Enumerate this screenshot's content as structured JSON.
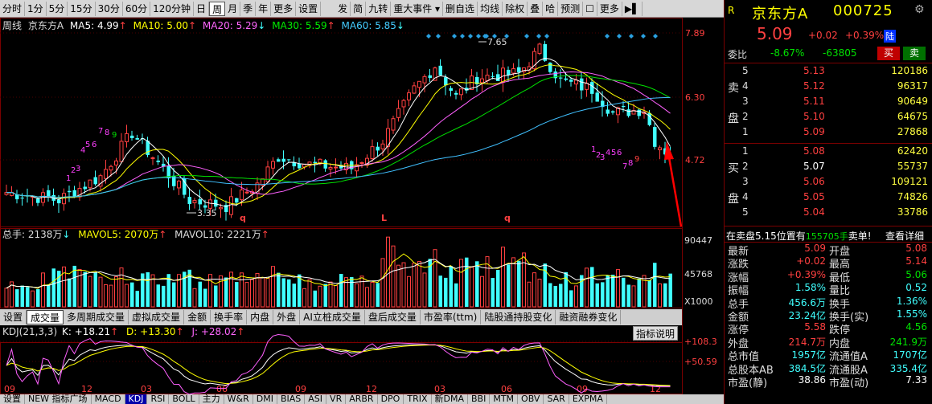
{
  "toolbar": {
    "left": [
      "分时",
      "1分",
      "5分",
      "15分",
      "30分",
      "60分",
      "120分钟",
      "日",
      "周",
      "月",
      "季",
      "年",
      "更多",
      "设置"
    ],
    "right": [
      "发",
      "简",
      "九转",
      "重大事件 ▾",
      "删自选",
      "均线",
      "除权",
      "叠",
      "哈",
      "预测",
      "☐",
      "更多"
    ],
    "selected": "周"
  },
  "legend": {
    "period": "周线",
    "name": "京东方A",
    "ma5": "MA5: 4.99",
    "ma10": "MA10: 5.00",
    "ma20": "MA20: 5.29",
    "ma30": "MA30: 5.59",
    "ma60": "MA60: 5.85",
    "ma5_arrow": "↑",
    "ma10_arrow": "↑",
    "ma20_arrow": "↓",
    "ma30_arrow": "↑",
    "ma60_arrow": "↓"
  },
  "price_axis": [
    "7.89",
    "6.30",
    "4.72"
  ],
  "annotations": {
    "high": "7.65",
    "low": "3.35",
    "marks": [
      "q",
      "L",
      "q"
    ]
  },
  "volume_legend": {
    "total": "总手: 2138万",
    "mavol5": "MAVOL5: 2070万",
    "mavol10": "MAVOL10: 2221万",
    "vol_arrow": "↓",
    "mavol5_arrow": "↑",
    "mavol10_arrow": "↑"
  },
  "volume_axis": [
    "90447",
    "45768",
    "X1000"
  ],
  "tabs": [
    "设置",
    "成交量",
    "多周期成交量",
    "虚拟成交量",
    "金额",
    "换手率",
    "内盘",
    "外盘",
    "AI立桩成交量",
    "盘后成交量",
    "市盈率(ttm)",
    "陆股通持股变化",
    "融资融券变化"
  ],
  "tabs_selected": "成交量",
  "kdj_legend": {
    "name": "KDJ(21,3,3)",
    "k": "K: +18.21",
    "d": "D: +13.30",
    "j": "J: +28.02",
    "k_arrow": "↑",
    "d_arrow": "↑",
    "j_arrow": "↑"
  },
  "kdj_axis": [
    "+108.3",
    "+50.59"
  ],
  "kdj_button": "指标说明",
  "bottom_tabs": [
    "设置",
    "NEW 指标广场",
    "MACD",
    "KDJ",
    "RSI",
    "BOLL",
    "主力",
    "W&R",
    "DMI",
    "BIAS",
    "ASI",
    "VR",
    "ARBR",
    "DPO",
    "TRIX",
    "新DMA",
    "BBI",
    "MTM",
    "OBV",
    "SAR",
    "EXPMA"
  ],
  "bottom_selected": "KDJ",
  "months": [
    "09",
    "12",
    "03",
    "06",
    "09",
    "12",
    "03",
    "06",
    "09",
    "12"
  ],
  "stock": {
    "r": "R",
    "name": "京东方A",
    "code": "000725",
    "price": "5.09",
    "chg": "+0.02",
    "pct": "+0.39%",
    "board": "陆"
  },
  "weibi": {
    "label": "委比",
    "pct": "-8.67%",
    "diff": "-63805",
    "buy": "买",
    "sell": "卖"
  },
  "asks": [
    {
      "n": "5",
      "p": "5.13",
      "v": "120186"
    },
    {
      "n": "4",
      "p": "5.12",
      "v": "96317"
    },
    {
      "n": "3",
      "p": "5.11",
      "v": "90649"
    },
    {
      "n": "2",
      "p": "5.10",
      "v": "64675"
    },
    {
      "n": "1",
      "p": "5.09",
      "v": "27868"
    }
  ],
  "ask_label": [
    "卖",
    "盘"
  ],
  "bids": [
    {
      "n": "1",
      "p": "5.08",
      "v": "62420"
    },
    {
      "n": "2",
      "p": "5.07",
      "v": "55737"
    },
    {
      "n": "3",
      "p": "5.06",
      "v": "109121"
    },
    {
      "n": "4",
      "p": "5.05",
      "v": "74826"
    },
    {
      "n": "5",
      "p": "5.04",
      "v": "33786"
    }
  ],
  "bid_label": [
    "买",
    "盘"
  ],
  "notice": {
    "text": "在卖盘5.15位置有",
    "vol": "155705手",
    "tail": "卖单!",
    "link": "查看详细"
  },
  "stats": [
    [
      "最新",
      "5.09",
      "开盘",
      "5.08"
    ],
    [
      "涨跌",
      "+0.02",
      "最高",
      "5.14"
    ],
    [
      "涨幅",
      "+0.39%",
      "最低",
      "5.06"
    ],
    [
      "振幅",
      "1.58%",
      "量比",
      "0.52"
    ],
    [
      "总手",
      "456.6万",
      "换手",
      "1.36%"
    ],
    [
      "金额",
      "23.24亿",
      "换手(实)",
      "1.55%"
    ],
    [
      "涨停",
      "5.58",
      "跌停",
      "4.56"
    ],
    [
      "外盘",
      "214.7万",
      "内盘",
      "241.9万"
    ],
    [
      "总市值",
      "1957亿",
      "流通值A",
      "1707亿"
    ],
    [
      "总股本AB",
      "384.5亿",
      "流通股A",
      "335.4亿"
    ],
    [
      "市盈(静)",
      "38.86",
      "市盈(动)",
      "7.33"
    ]
  ],
  "colors": {
    "up": "#ff4040",
    "down": "#40ffff",
    "ma5": "#ffffff",
    "ma10": "#ffff00",
    "ma20": "#ff60ff",
    "ma30": "#00e000",
    "ma60": "#40c0ff",
    "axis": "#7a0000"
  }
}
